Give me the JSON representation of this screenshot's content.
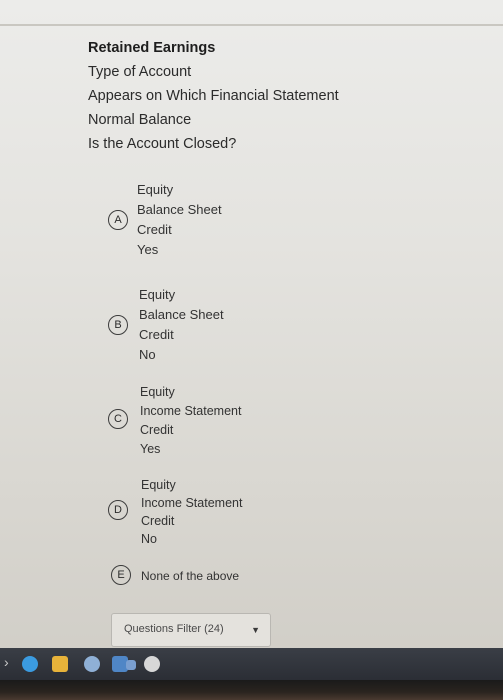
{
  "question": {
    "title": "Retained Earnings",
    "lines": [
      "Type of Account",
      "Appears on Which Financial Statement",
      "Normal Balance",
      "Is the Account Closed?"
    ]
  },
  "options": [
    {
      "letter": "A",
      "lines": [
        "Equity",
        "Balance Sheet",
        "Credit",
        "Yes"
      ]
    },
    {
      "letter": "B",
      "lines": [
        "Equity",
        "Balance Sheet",
        "Credit",
        "No"
      ]
    },
    {
      "letter": "C",
      "lines": [
        "Equity",
        "Income Statement",
        "Credit",
        "Yes"
      ]
    },
    {
      "letter": "D",
      "lines": [
        "Equity",
        "Income Statement",
        "Credit",
        "No"
      ]
    },
    {
      "letter": "E",
      "label": "None of the above"
    }
  ],
  "filter": {
    "label": "Questions Filter (24)",
    "caret": "▼"
  },
  "taskbar": {
    "arrow": "›",
    "icons": [
      {
        "name": "edge-icon",
        "color": "#3b9be0"
      },
      {
        "name": "chrome-icon",
        "color": "#e8b33a"
      },
      {
        "name": "gear-icon",
        "color": "#8fb0d6"
      },
      {
        "name": "app-icon",
        "color": "#4f86c6"
      },
      {
        "name": "task-view-icon",
        "color": "#7a9fd0"
      },
      {
        "name": "play-icon",
        "color": "#d7d7d7"
      }
    ]
  }
}
